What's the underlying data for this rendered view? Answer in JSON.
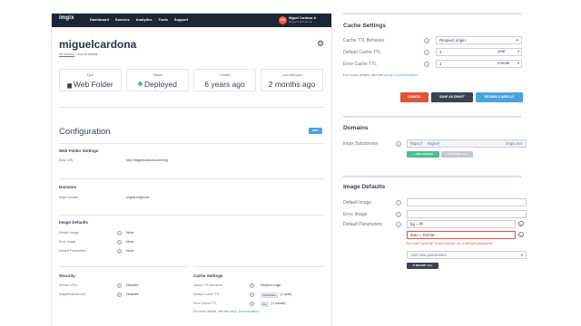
{
  "nav": {
    "logo_text": "imgix",
    "links": [
      "Dashboard",
      "Sources",
      "Analytics",
      "Tools",
      "Support"
    ],
    "avatar_initials": "CM",
    "user_name": "Miguel Cardona Jr",
    "user_org": "Miguel Cardona Inc"
  },
  "source": {
    "title": "miguelcardona",
    "breadcrumb_link": "All sources",
    "breadcrumb_sep": " / ",
    "breadcrumb_current": "Source details"
  },
  "stats": [
    {
      "label": "Type",
      "value": "Web Folder",
      "icon": "folder-icon"
    },
    {
      "label": "Status",
      "value": "Deployed",
      "icon": "status-dot-icon"
    },
    {
      "label": "Created",
      "value": "6 years ago",
      "icon": ""
    },
    {
      "label": "Last Deployed",
      "value": "2 months ago",
      "icon": ""
    }
  ],
  "configuration": {
    "heading": "Configuration",
    "edit_label": "EDIT",
    "web_folder": {
      "heading": "Web Folder Settings",
      "base_url_label": "Base URL",
      "base_url_value": "http://miguelcardona.com/img"
    },
    "domains": {
      "heading": "Domains",
      "label": "imgix Domain",
      "value": "miguel.imgix.net"
    },
    "image_defaults": {
      "heading": "Image Defaults",
      "rows": [
        {
          "label": "Default Image",
          "value": "None"
        },
        {
          "label": "Error Image",
          "value": "None"
        },
        {
          "label": "Default Parameters",
          "value": "None"
        }
      ]
    },
    "security": {
      "heading": "Security",
      "rows": [
        {
          "label": "Secure URLs",
          "value": "Disabled"
        },
        {
          "label": "mixpaSecured.xml",
          "value": "Disabled"
        }
      ]
    },
    "cache": {
      "heading": "Cache Settings",
      "behavior_label": "Cache TTL Behavior",
      "behavior_value": "Respect origin",
      "default_label": "Default Cache TTL",
      "default_value": "31536000s",
      "default_note": "(1 year)",
      "error_label": "Error Cache TTL",
      "error_value": "60s",
      "error_note": "(1 minute)",
      "hint_prefix": "For more details, see the ",
      "hint_link": "setup documentation"
    }
  },
  "edit_cache": {
    "heading": "Cache Settings",
    "behavior_label": "Cache TTL Behavior",
    "behavior_value": "Respect origin",
    "default_label": "Default Cache TTL",
    "default_number": "1",
    "default_unit": "year",
    "error_label": "Error Cache TTL",
    "error_number": "1",
    "error_unit": "minute",
    "hint_prefix": "For more details, see the ",
    "hint_link": "setup documentation",
    "hint_suffix": "."
  },
  "actions": {
    "cancel": "CANCEL",
    "save_draft": "SAVE AS DRAFT",
    "review_deploy": "REVIEW & DEPLOY"
  },
  "edit_domains": {
    "heading": "Domains",
    "subdomain_label": "imgix Subdomain",
    "prefix": "https://",
    "subdomain_value": "miguel",
    "suffix": "imgix.net",
    "add_domain": "+ ADD DOMAIN",
    "revert_all": "↺ REVERT ALL"
  },
  "edit_image_defaults": {
    "heading": "Image Defaults",
    "default_image_label": "Default Image",
    "default_image_value": "",
    "error_image_label": "Error Image",
    "error_image_value": "",
    "params_label": "Default Parameters",
    "param_1": "bg = fff",
    "param_2": "auto = format",
    "error_message": "You can't specify \"auto=format\" as a default parameter",
    "add_param_placeholder": "Add new parameter...",
    "revert_all": "↺ REVERT ALL"
  },
  "colors": {
    "nav_bg": "#1d2533",
    "accent_red": "#e0533a",
    "accent_blue": "#4aa3df",
    "draft_dark": "#3b4150",
    "success_green": "#4cbf8a"
  }
}
